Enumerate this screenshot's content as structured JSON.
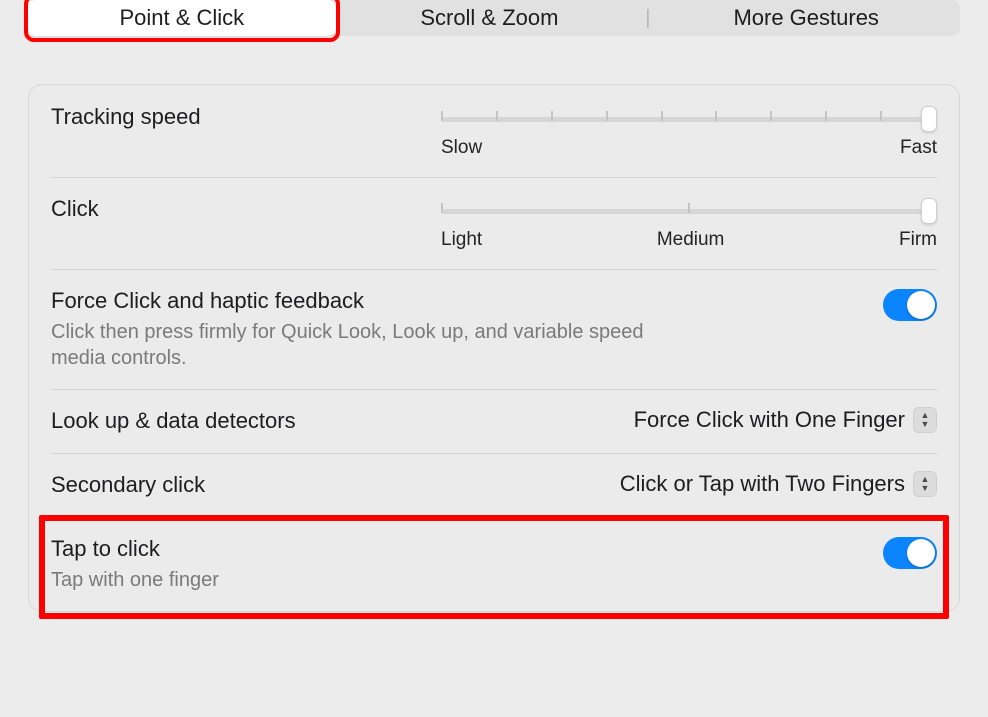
{
  "tabs": {
    "point_click": "Point & Click",
    "scroll_zoom": "Scroll & Zoom",
    "more_gestures": "More Gestures"
  },
  "tracking_speed": {
    "title": "Tracking speed",
    "min_label": "Slow",
    "max_label": "Fast"
  },
  "click": {
    "title": "Click",
    "min_label": "Light",
    "mid_label": "Medium",
    "max_label": "Firm"
  },
  "force_click": {
    "title": "Force Click and haptic feedback",
    "desc": "Click then press firmly for Quick Look, Look up, and variable speed media controls."
  },
  "lookup": {
    "title": "Look up & data detectors",
    "value": "Force Click with One Finger"
  },
  "secondary": {
    "title": "Secondary click",
    "value": "Click or Tap with Two Fingers"
  },
  "tap_to_click": {
    "title": "Tap to click",
    "desc": "Tap with one finger"
  }
}
